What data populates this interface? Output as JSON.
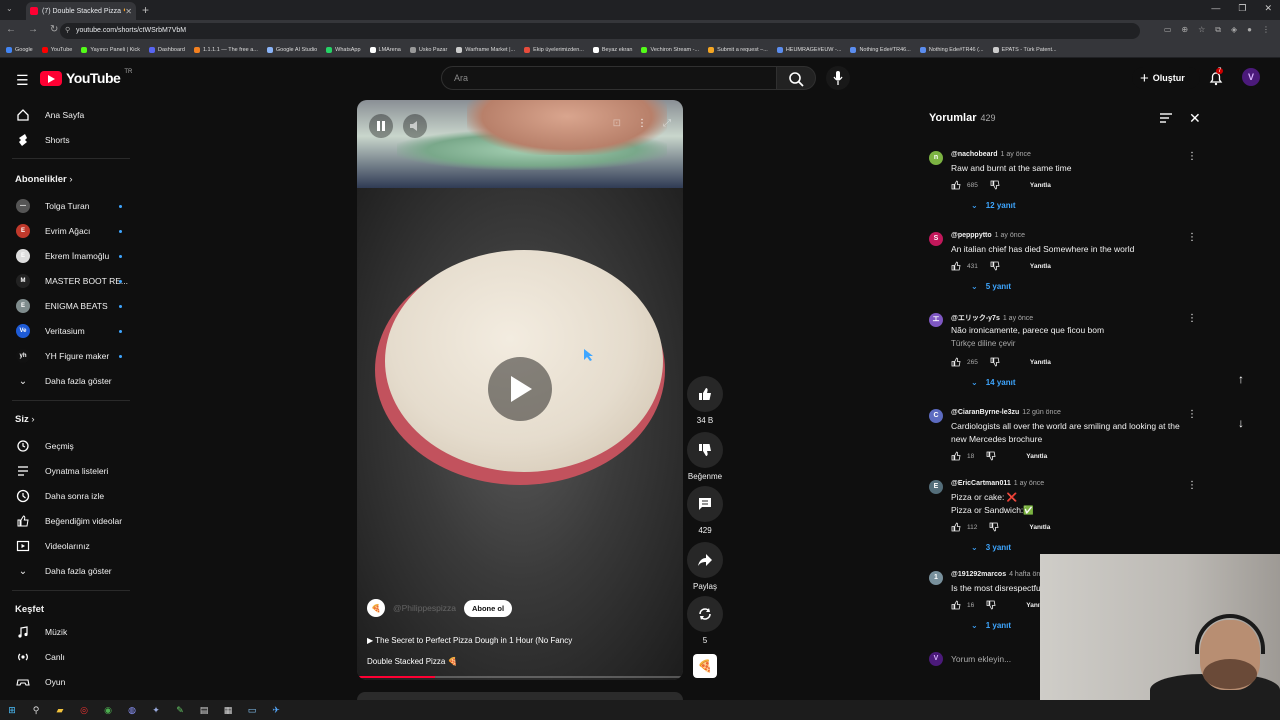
{
  "browser": {
    "tab_title": "(7) Double Stacked Pizza 🍕 - Yo...",
    "url": "youtube.com/shorts/ctWSrbM7VbM",
    "window_controls": [
      "—",
      "❐",
      "✕"
    ],
    "bookmarks": [
      {
        "label": "Google",
        "color": "#4285f4"
      },
      {
        "label": "YouTube",
        "color": "#ff0000"
      },
      {
        "label": "Yayıncı Paneli | Kick",
        "color": "#53fc18"
      },
      {
        "label": "Dashboard",
        "color": "#5865f2"
      },
      {
        "label": "1.1.1.1 — The free a...",
        "color": "#f38020"
      },
      {
        "label": "Google AI Studio",
        "color": "#8ab4f8"
      },
      {
        "label": "WhatsApp",
        "color": "#25d366"
      },
      {
        "label": "LMArena",
        "color": "#ffffff"
      },
      {
        "label": "Usko Pazar",
        "color": "#999999"
      },
      {
        "label": "Warframe Market |...",
        "color": "#cccccc"
      },
      {
        "label": "Ekip üyelerimizden...",
        "color": "#e74c3c"
      },
      {
        "label": "Beyaz ekran",
        "color": "#ffffff"
      },
      {
        "label": "Vechiron Stream -...",
        "color": "#53fc18"
      },
      {
        "label": "Submit a request –...",
        "color": "#f5a623"
      },
      {
        "label": "HEUMRAGE#EUW -...",
        "color": "#5b8def"
      },
      {
        "label": "Nothing Ede#TR46...",
        "color": "#5b8def"
      },
      {
        "label": "Nothing Ede#TR46 (...",
        "color": "#5b8def"
      },
      {
        "label": "EPATS - Türk Patent...",
        "color": "#cccccc"
      }
    ]
  },
  "header": {
    "logo_text": "YouTube",
    "logo_region": "TR",
    "search_placeholder": "Ara",
    "create_label": "Oluştur",
    "notifications_count": "7",
    "avatar_letter": "V"
  },
  "sidebar": {
    "main": [
      {
        "label": "Ana Sayfa",
        "icon": "home-icon"
      },
      {
        "label": "Shorts",
        "icon": "shorts-icon"
      }
    ],
    "subs_heading": "Abonelikler",
    "subscriptions": [
      {
        "label": "Tolga Turan",
        "color": "#555555",
        "initial": "—"
      },
      {
        "label": "Evrim Ağacı",
        "color": "#c0392b",
        "initial": "E"
      },
      {
        "label": "Ekrem İmamoğlu",
        "color": "#dddddd",
        "initial": "E"
      },
      {
        "label": "MASTER BOOT RE...",
        "color": "#222222",
        "initial": "M"
      },
      {
        "label": "ENIGMA BEATS",
        "color": "#7f8c8d",
        "initial": "E"
      },
      {
        "label": "Veritasium",
        "color": "#1e5bd6",
        "initial": "Ve"
      },
      {
        "label": "YH Figure maker",
        "color": "#111111",
        "initial": "yh"
      }
    ],
    "subs_more": "Daha fazla göster",
    "you_heading": "Siz",
    "you": [
      {
        "label": "Geçmiş",
        "icon": "history-icon"
      },
      {
        "label": "Oynatma listeleri",
        "icon": "playlists-icon"
      },
      {
        "label": "Daha sonra izle",
        "icon": "watch-later-icon"
      },
      {
        "label": "Beğendiğim videolar",
        "icon": "liked-icon"
      },
      {
        "label": "Videolarınız",
        "icon": "your-videos-icon"
      }
    ],
    "you_more": "Daha fazla göster",
    "explore_heading": "Keşfet",
    "explore": [
      {
        "label": "Müzik",
        "icon": "music-icon"
      },
      {
        "label": "Canlı",
        "icon": "live-icon"
      },
      {
        "label": "Oyun",
        "icon": "gaming-icon"
      }
    ]
  },
  "short": {
    "channel": "@Philippespizza",
    "subscribe_label": "Abone ol",
    "title_line1": "▶ The Secret to Perfect Pizza Dough in 1 Hour (No Fancy",
    "title_line2": "Double Stacked Pizza 🍕",
    "progress": 0.24,
    "actions": {
      "likes": "34 B",
      "dislike_label": "Beğenme",
      "comments": "429",
      "share_label": "Paylaş",
      "remix": "5"
    }
  },
  "comments": {
    "title": "Yorumlar",
    "count": "429",
    "add_placeholder": "Yorum ekleyin...",
    "items": [
      {
        "user": "@nachobeard",
        "time": "1 ay önce",
        "text": "Raw and burnt at the same time",
        "likes": "685",
        "reply": "Yanıtla",
        "replies": "12 yanıt",
        "color": "#7cb342",
        "initial": "n"
      },
      {
        "user": "@pepppytto",
        "time": "1 ay önce",
        "text": "An italian chief has died Somewhere in the world",
        "likes": "431",
        "reply": "Yanıtla",
        "replies": "5 yanıt",
        "color": "#c2185b",
        "initial": "S"
      },
      {
        "user": "@エリック-y7s",
        "time": "1 ay önce",
        "text": "Não ironicamente, parece que ficou bom",
        "translate": "Türkçe diline çevir",
        "likes": "265",
        "reply": "Yanıtla",
        "replies": "14 yanıt",
        "color": "#7e57c2",
        "initial": "エ"
      },
      {
        "user": "@CiaranByrne-le3zu",
        "time": "12 gün önce",
        "text": "Cardiologists all over the world are smiling and looking at the new Mercedes brochure",
        "likes": "18",
        "reply": "Yanıtla",
        "color": "#5c6bc0",
        "initial": "C"
      },
      {
        "user": "@EricCartman011",
        "time": "1 ay önce",
        "text": "Pizza or cake: ❌",
        "text2": "Pizza or Sandwich:✅",
        "likes": "112",
        "reply": "Yanıtla",
        "replies": "3 yanıt",
        "color": "#546e7a",
        "initial": "E"
      },
      {
        "user": "@191292marcos",
        "time": "4 hafta önce",
        "text": "Is the most disrespectful",
        "likes": "16",
        "reply": "Yanıtla",
        "replies": "1 yanıt",
        "color": "#78909c",
        "initial": "1"
      }
    ]
  }
}
